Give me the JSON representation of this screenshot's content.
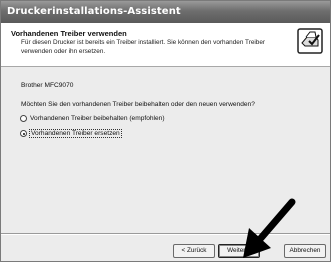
{
  "window": {
    "title": "Druckerinstallations-Assistent"
  },
  "header": {
    "title": "Vorhandenen Treiber verwenden",
    "description": "Für diesen Drucker ist bereits ein Treiber installiert. Sie können den vorhanden Treiber verwenden oder ihn ersetzen.",
    "icon": "printer-check-icon"
  },
  "content": {
    "driver_name": "Brother MFC9070",
    "question": "Möchten Sie den vorhandenen Treiber beibehalten oder den neuen verwenden?",
    "options": [
      {
        "label": "Vorhandenen Treiber beibehalten (empfohlen)",
        "selected": false
      },
      {
        "label": "Vorhandenen Treiber ersetzen",
        "selected": true
      }
    ]
  },
  "buttons": {
    "back": "< Zurück",
    "next": "Weiter >",
    "cancel": "Abbrechen"
  },
  "annotation": {
    "icon": "pointing-arrow-icon"
  }
}
